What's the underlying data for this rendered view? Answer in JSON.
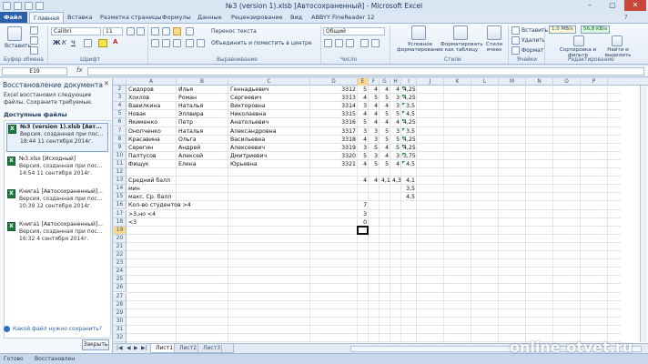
{
  "window": {
    "title": "№3 (version 1).xlsb [Автосохраненный] - Microsoft Excel",
    "controls": [
      "–",
      "▢",
      "✕"
    ]
  },
  "tabs": [
    "Файл",
    "Главная",
    "Вставка",
    "Разметка страницы",
    "Формулы",
    "Данные",
    "Рецензирование",
    "Вид",
    "ABBYY FineReader 12"
  ],
  "ribbon": {
    "paste": "Вставить",
    "clipboard_group": "Буфер обмена",
    "font_name": "Calibri",
    "font_size": "11",
    "font_group": "Шрифт",
    "wrap_text": "Перенос текста",
    "merge_center": "Объединить и поместить в центре",
    "alignment_group": "Выравнивание",
    "number_format": "Общий",
    "number_group": "Число",
    "cond_format": "Условное форматирование",
    "format_table": "Форматировать как таблицу",
    "cell_styles": "Стили ячеек",
    "styles_group": "Стили",
    "insert": "Вставить",
    "delete": "Удалить",
    "format": "Формат",
    "cells_group": "Ячейки",
    "sort_filter": "Сортировка и фильтр",
    "find_select": "Найти и выделить",
    "editing_group": "Редактирование",
    "net_down": "1,0 MB/s",
    "net_up": "56,8 KB/s"
  },
  "formula_bar": {
    "name_box": "E19",
    "fx": "fx",
    "value": ""
  },
  "recovery": {
    "title": "Восстановление документа",
    "description": "Excel восстановил следующие файлы. Сохраните требуемые.",
    "available_label": "Доступные файлы",
    "files": [
      {
        "name": "№3 (version 1).xlsb [Авт...",
        "desc": "Версия, созданная при пос...",
        "time": "18:44 11 сентября 2014г."
      },
      {
        "name": "№3.xlsx [Исходный]",
        "desc": "Версия, созданная при пос...",
        "time": "14:54 11 сентября 2014г."
      },
      {
        "name": "Книга1 [Автосохраненный]...",
        "desc": "Версия, созданная при пос...",
        "time": "10:39 12 сентября 2014г."
      },
      {
        "name": "Книга1 [Автосохраненный]...",
        "desc": "Версия, созданная при пос...",
        "time": "16:32 4 сентября 2014г."
      }
    ],
    "help_link": "Какой файл нужно сохранить?",
    "close_button": "Закрыть"
  },
  "sheet": {
    "columns": [
      "A",
      "B",
      "C",
      "D",
      "E",
      "F",
      "G",
      "H",
      "I",
      "J",
      "K",
      "L",
      "M",
      "N",
      "O",
      "P"
    ],
    "selected_column": "E",
    "row_numbers": [
      "2",
      "3",
      "4",
      "5",
      "6",
      "7",
      "8",
      "9",
      "10",
      "11",
      "12",
      "13",
      "14",
      "15",
      "16",
      "17",
      "18",
      "19",
      "20",
      "21",
      "22",
      "23",
      "24",
      "25",
      "26",
      "27",
      "28",
      "29",
      "30",
      "31",
      "32",
      "33"
    ],
    "selected_row": "19",
    "students": [
      {
        "a": "Сидоров",
        "b": "Илья",
        "c": "Геннадьевич",
        "d": "3312",
        "e": "5",
        "f": "4",
        "g": "4",
        "h": "4",
        "i": "4,25"
      },
      {
        "a": "Хохлов",
        "b": "Роман",
        "c": "Сергеевич",
        "d": "3313",
        "e": "4",
        "f": "5",
        "g": "5",
        "h": "3",
        "i": "4,25"
      },
      {
        "a": "Вавилкина",
        "b": "Наталья",
        "c": "Викторовна",
        "d": "3314",
        "e": "3",
        "f": "4",
        "g": "4",
        "h": "3",
        "i": "3,5"
      },
      {
        "a": "Новак",
        "b": "Эллвира",
        "c": "Николаевна",
        "d": "3315",
        "e": "4",
        "f": "4",
        "g": "5",
        "h": "5",
        "i": "4,5"
      },
      {
        "a": "Якименко",
        "b": "Петр",
        "c": "Анатольевич",
        "d": "3316",
        "e": "5",
        "f": "4",
        "g": "4",
        "h": "4",
        "i": "4,25"
      },
      {
        "a": "Онопченко",
        "b": "Наталья",
        "c": "Александровна",
        "d": "3317",
        "e": "3",
        "f": "3",
        "g": "5",
        "h": "3",
        "i": "3,5"
      },
      {
        "a": "Красавина",
        "b": "Ольга",
        "c": "Васильевна",
        "d": "3318",
        "e": "4",
        "f": "3",
        "g": "5",
        "h": "5",
        "i": "4,25"
      },
      {
        "a": "Серегин",
        "b": "Андрей",
        "c": "Алексеевич",
        "d": "3319",
        "e": "3",
        "f": "5",
        "g": "4",
        "h": "5",
        "i": "4,25"
      },
      {
        "a": "Палтусов",
        "b": "Алексей",
        "c": "Дмитриевич",
        "d": "3320",
        "e": "5",
        "f": "3",
        "g": "4",
        "h": "3",
        "i": "3,75"
      },
      {
        "a": "Фищук",
        "b": "Елена",
        "c": "Юрьевна",
        "d": "3321",
        "e": "4",
        "f": "5",
        "g": "5",
        "h": "4",
        "i": "4,5"
      }
    ],
    "stats": {
      "avg_label": "Средний балл",
      "avg_e": "4",
      "avg_f": "4",
      "avg_g": "4,1",
      "avg_h": "4,3",
      "avg_i": "4,1",
      "min_label": "мин",
      "min_i": "3,5",
      "max_label": "макс. Ср. балл",
      "max_i": "4,5",
      "count_gt4_label": "Кол-во студентов >4",
      "count_gt4": "7",
      "count_3_4_label": ">3,но <4",
      "count_3_4": "3",
      "count_lt3_label": "<3",
      "count_lt3": "0"
    },
    "sheet_tabs": [
      "Лист1",
      "Лист2",
      "Лист3"
    ],
    "active_sheet": "Лист1"
  },
  "status": {
    "ready": "Готово",
    "recovered": "Восстановлен"
  },
  "watermark": "online-otvet.ru"
}
